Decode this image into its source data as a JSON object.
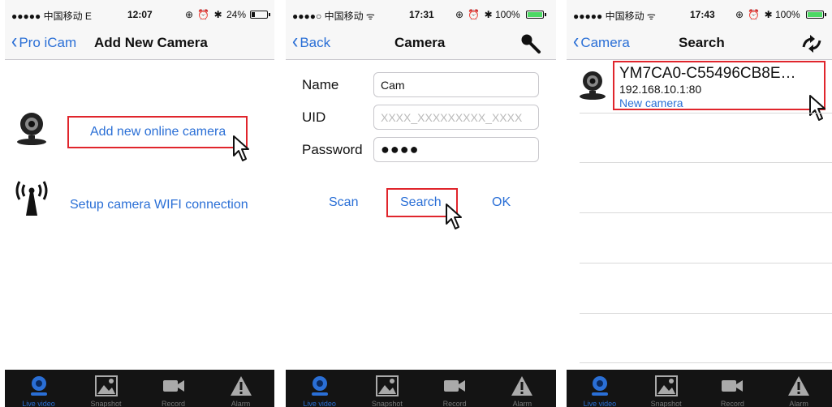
{
  "screens": [
    {
      "status": {
        "carrier": "●●●●● 中国移动  E",
        "time": "12:07",
        "icons": "⊕ ⏰ ✱",
        "battery": "24%",
        "battery_level": 0.24
      },
      "nav": {
        "back_label": "Pro iCam",
        "title": "Add New Camera"
      },
      "options": [
        {
          "label": "Add new online camera",
          "icon": "webcam-icon"
        },
        {
          "label": "Setup camera WIFI connection",
          "icon": "wifi-antenna-icon"
        }
      ]
    },
    {
      "status": {
        "carrier": "●●●●○ 中国移动 ᯤ",
        "time": "17:31",
        "icons": "⊕ ⏰ ✱",
        "battery": "100%",
        "battery_level": 1.0
      },
      "nav": {
        "back_label": "Back",
        "title": "Camera",
        "right_icon": "search-icon"
      },
      "form": {
        "name_label": "Name",
        "name_value": "Cam",
        "uid_label": "UID",
        "uid_placeholder": "XXXX_XXXXXXXXX_XXXX",
        "password_label": "Password",
        "password_value": "●●●●"
      },
      "actions": {
        "scan": "Scan",
        "search": "Search",
        "ok": "OK"
      }
    },
    {
      "status": {
        "carrier": "●●●●● 中国移动 ᯤ",
        "time": "17:43",
        "icons": "⊕ ⏰ ✱",
        "battery": "100%",
        "battery_level": 1.0
      },
      "nav": {
        "back_label": "Camera",
        "title": "Search",
        "right_icon": "refresh-icon"
      },
      "result": {
        "name": "YM7CA0-C55496CB8E…",
        "ip": "192.168.10.1:80",
        "label": "New camera"
      }
    }
  ],
  "tabbar": [
    {
      "label": "Live video",
      "icon": "live-video-icon"
    },
    {
      "label": "Snapshot",
      "icon": "snapshot-icon"
    },
    {
      "label": "Record",
      "icon": "record-icon"
    },
    {
      "label": "Alarm",
      "icon": "alarm-icon"
    }
  ],
  "colors": {
    "accent": "#2a6fd6",
    "highlight": "#e0252c",
    "tabbar": "#141414"
  }
}
